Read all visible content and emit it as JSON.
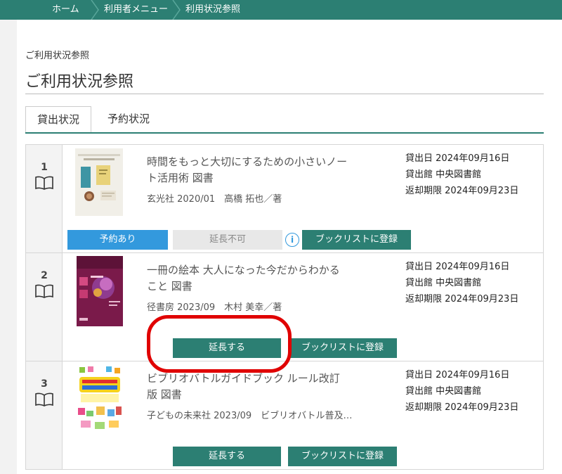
{
  "breadcrumb": {
    "items": [
      {
        "label": "ホーム"
      },
      {
        "label": "利用者メニュー"
      },
      {
        "label": "利用状況参照"
      }
    ]
  },
  "page": {
    "small_title": "ご利用状況参照",
    "title": "ご利用状況参照"
  },
  "tabs": [
    {
      "label": "貸出状況",
      "active": true
    },
    {
      "label": "予約状況",
      "active": false
    }
  ],
  "labels": {
    "loan_date": "貸出日",
    "loan_library": "貸出館",
    "due_date": "返却期限"
  },
  "items": [
    {
      "number": "1",
      "title_line1": "時間をもっと大切にするための小さいノー",
      "title_line2": "ト活用術 図書",
      "meta": "玄光社 2020/01　高橋 拓也／著",
      "loan_date": "2024年09月16日",
      "loan_library": "中央図書館",
      "due_date": "2024年09月23日",
      "reserved_label": "予約あり",
      "extend_label": "延長不可",
      "booklist_label": "ブックリストに登録",
      "info_icon": "i"
    },
    {
      "number": "2",
      "title_line1": "一冊の絵本 大人になった今だからわかる",
      "title_line2": "こと 図書",
      "meta": "径書房 2023/09　木村 美幸／著",
      "loan_date": "2024年09月16日",
      "loan_library": "中央図書館",
      "due_date": "2024年09月23日",
      "extend_label": "延長する",
      "booklist_label": "ブックリストに登録"
    },
    {
      "number": "3",
      "title_line1": "ビブリオバトルガイドブック ルール改訂",
      "title_line2": "版 図書",
      "meta": "子どもの未来社 2023/09　ビブリオバトル普及…",
      "loan_date": "2024年09月16日",
      "loan_library": "中央図書館",
      "due_date": "2024年09月23日",
      "extend_label": "延長する",
      "booklist_label": "ブックリストに登録"
    }
  ],
  "colors": {
    "accent": "#2c7f73",
    "reserved": "#3399dd",
    "disabled": "#e8e8e8",
    "highlight": "#e00000"
  }
}
